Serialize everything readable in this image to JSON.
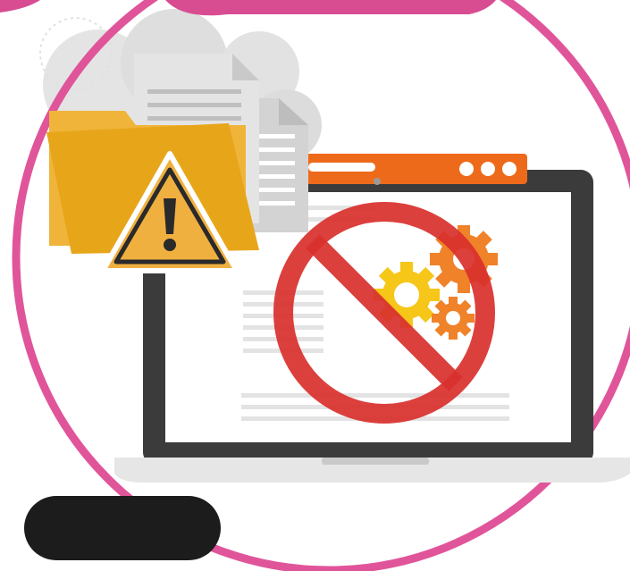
{
  "scene": {
    "icons": [
      "decorative-ring-icon",
      "folder-icon",
      "document-icon",
      "warning-icon",
      "laptop-icon",
      "browser-window-icon",
      "prohibited-icon",
      "gear-icon"
    ],
    "window_controls": [
      "dot",
      "dot",
      "dot"
    ]
  },
  "colors": {
    "ring": "#e0559a",
    "ring_top": "#d84c92",
    "folder_front": "#e7a61a",
    "folder_back": "#f0b43a",
    "warning_fill": "#f0b040",
    "warning_stroke": "#2a2a2a",
    "laptop_bezel": "#3b3b3b",
    "laptop_base": "#e6e6e6",
    "browser_bar": "#ee6a1b",
    "prohibited": "#d9302d",
    "gear_yellow": "#f6c619",
    "gear_orange": "#f0822a",
    "bubble": "#d8d8d8",
    "pill": "#1c1c1c"
  }
}
